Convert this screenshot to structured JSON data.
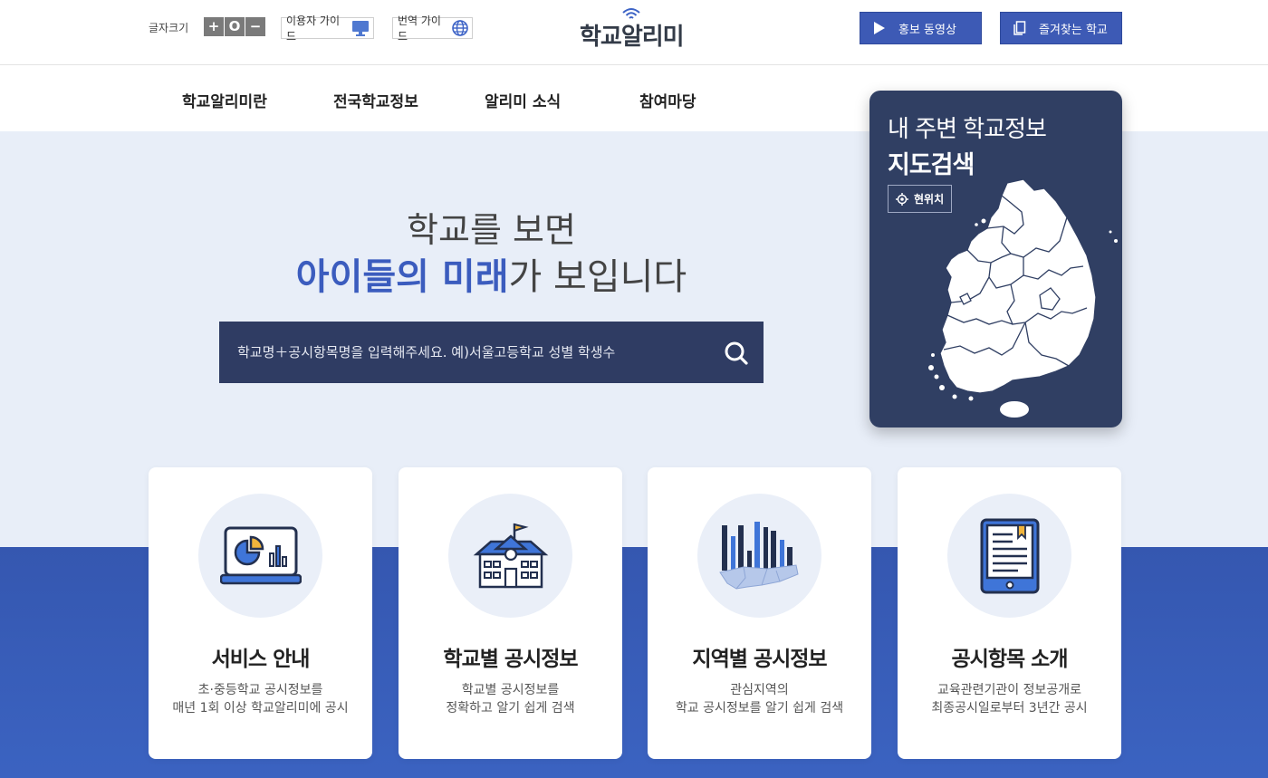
{
  "topbar": {
    "font_size_label": "글자크기",
    "font_size_buttons": [
      "+",
      "O",
      "−"
    ],
    "user_guide": "이용자 가이드",
    "translation_guide": "번역 가이드",
    "logo": "학교알리미",
    "promo_video": "홍보 동영상",
    "favorites": "즐겨찾는 학교"
  },
  "nav": {
    "items": [
      "학교알리미란",
      "전국학교정보",
      "알리미 소식",
      "참여마당"
    ]
  },
  "hero": {
    "line1": "학교를 보면",
    "highlight": "아이들의 미래",
    "rest": "가 보입니다"
  },
  "search": {
    "placeholder": "학교명＋공시항목명을 입력해주세요. 예)서울고등학교 성별 학생수"
  },
  "map_card": {
    "line1": "내 주변 학교정보",
    "line2": "지도검색",
    "location_button": "현위치"
  },
  "cards": [
    {
      "title": "서비스 안내",
      "desc1": "초·중등학교 공시정보를",
      "desc2": "매년 1회 이상 학교알리미에 공시"
    },
    {
      "title": "학교별 공시정보",
      "desc1": "학교별 공시정보를",
      "desc2": "정확하고 알기 쉽게 검색"
    },
    {
      "title": "지역별 공시정보",
      "desc1": "관심지역의",
      "desc2": "학교 공시정보를 알기 쉽게 검색"
    },
    {
      "title": "공시항목 소개",
      "desc1": "교육관련기관이 정보공개로",
      "desc2": "최종공시일로부터 3년간 공시"
    }
  ],
  "colors": {
    "primary": "#3d5ab5",
    "navy": "#303f63",
    "hero_bg": "#e8eef8",
    "highlight": "#3b5cbe"
  }
}
